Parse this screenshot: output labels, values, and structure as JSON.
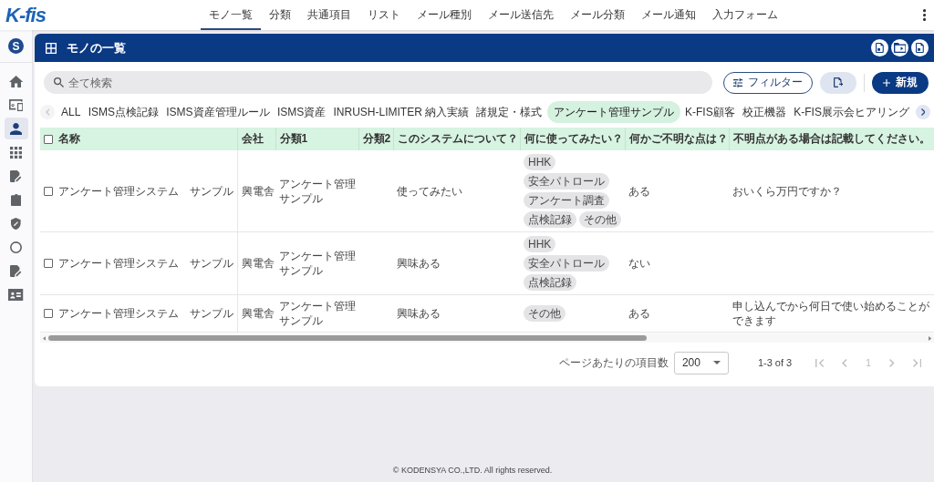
{
  "header": {
    "logo": "K-fis",
    "nav": [
      {
        "label": "モノ一覧",
        "selected": true
      },
      {
        "label": "分類",
        "selected": false
      },
      {
        "label": "共通項目",
        "selected": false
      },
      {
        "label": "リスト",
        "selected": false
      },
      {
        "label": "メール種別",
        "selected": false
      },
      {
        "label": "メール送信先",
        "selected": false
      },
      {
        "label": "メール分類",
        "selected": false
      },
      {
        "label": "メール通知",
        "selected": false
      },
      {
        "label": "入力フォーム",
        "selected": false
      }
    ]
  },
  "sidebar": {
    "badge": "S",
    "items": [
      {
        "kind": "home",
        "selected": false
      },
      {
        "kind": "devices",
        "selected": false
      },
      {
        "kind": "person",
        "selected": true
      },
      {
        "kind": "apps",
        "selected": false
      },
      {
        "kind": "edit-note",
        "selected": false
      },
      {
        "kind": "clipboard",
        "selected": false
      },
      {
        "kind": "shield",
        "selected": false
      },
      {
        "kind": "ring",
        "selected": false
      },
      {
        "kind": "edit-note",
        "selected": false
      },
      {
        "kind": "id-card",
        "selected": false
      }
    ]
  },
  "panel": {
    "title": "モノの一覧",
    "actions": [
      {
        "kind": "file"
      },
      {
        "kind": "folder"
      },
      {
        "kind": "file"
      }
    ],
    "search": {
      "placeholder": "全て検索"
    },
    "filter_button": "フィルター",
    "new_button": "新規",
    "tabs": {
      "left_disabled": true,
      "right_disabled": false,
      "items": [
        {
          "label": "ALL",
          "selected": false
        },
        {
          "label": "ISMS点検記録",
          "selected": false
        },
        {
          "label": "ISMS資産管理ルール",
          "selected": false
        },
        {
          "label": "ISMS資産",
          "selected": false
        },
        {
          "label": "INRUSH-LIMITER 納入実績",
          "selected": false
        },
        {
          "label": "諸規定・様式",
          "selected": false
        },
        {
          "label": "アンケート管理サンプル",
          "selected": true
        },
        {
          "label": "K-FIS顧客",
          "selected": false
        },
        {
          "label": "校正機器",
          "selected": false
        },
        {
          "label": "K-FIS展示会ヒアリング",
          "selected": false
        }
      ]
    },
    "table": {
      "select_all_checked": false,
      "columns": [
        "名称",
        "会社",
        "分類1",
        "分類2",
        "このシステムについて？",
        "何に使ってみたい？",
        "何かご不明な点は？",
        "不明点がある場合は記載してください。"
      ],
      "rows": [
        {
          "checked": false,
          "cells": [
            {
              "kind": "text",
              "text": "アンケート管理システム　サンプル"
            },
            {
              "kind": "text",
              "text": "興電舎"
            },
            {
              "kind": "text",
              "text": "アンケート管理サンプル"
            },
            {
              "kind": "empty"
            },
            {
              "kind": "text",
              "text": "使ってみたい"
            },
            {
              "kind": "chips",
              "chips": [
                "HHK",
                "安全パトロール",
                "アンケート調査",
                "点検記録",
                "その他"
              ]
            },
            {
              "kind": "text",
              "text": "ある"
            },
            {
              "kind": "text",
              "text": "おいくら万円ですか？"
            }
          ]
        },
        {
          "checked": false,
          "cells": [
            {
              "kind": "text",
              "text": "アンケート管理システム　サンプル"
            },
            {
              "kind": "text",
              "text": "興電舎"
            },
            {
              "kind": "text",
              "text": "アンケート管理サンプル"
            },
            {
              "kind": "empty"
            },
            {
              "kind": "text",
              "text": "興味ある"
            },
            {
              "kind": "chips",
              "chips": [
                "HHK",
                "安全パトロール",
                "点検記録"
              ]
            },
            {
              "kind": "text",
              "text": "ない"
            },
            {
              "kind": "empty"
            }
          ]
        },
        {
          "checked": false,
          "cells": [
            {
              "kind": "text",
              "text": "アンケート管理システム　サンプル"
            },
            {
              "kind": "text",
              "text": "興電舎"
            },
            {
              "kind": "text",
              "text": "アンケート管理サンプル"
            },
            {
              "kind": "empty"
            },
            {
              "kind": "text",
              "text": "興味ある"
            },
            {
              "kind": "chips",
              "chips": [
                "その他"
              ]
            },
            {
              "kind": "text",
              "text": "ある"
            },
            {
              "kind": "text",
              "text": "申し込んでから何日で使い始めることができます"
            }
          ]
        }
      ]
    },
    "pagination": {
      "per_page_label": "ページあたりの項目数",
      "per_page": "200",
      "range": "1-3 of 3",
      "buttons": [
        {
          "kind": "first",
          "disabled": true
        },
        {
          "kind": "prev",
          "disabled": true
        },
        {
          "kind": "page",
          "label": "1",
          "disabled": true
        },
        {
          "kind": "next",
          "disabled": true
        },
        {
          "kind": "last",
          "disabled": true
        }
      ]
    }
  },
  "footer": "© KODENSYA CO.,LTD. All rights reserved."
}
